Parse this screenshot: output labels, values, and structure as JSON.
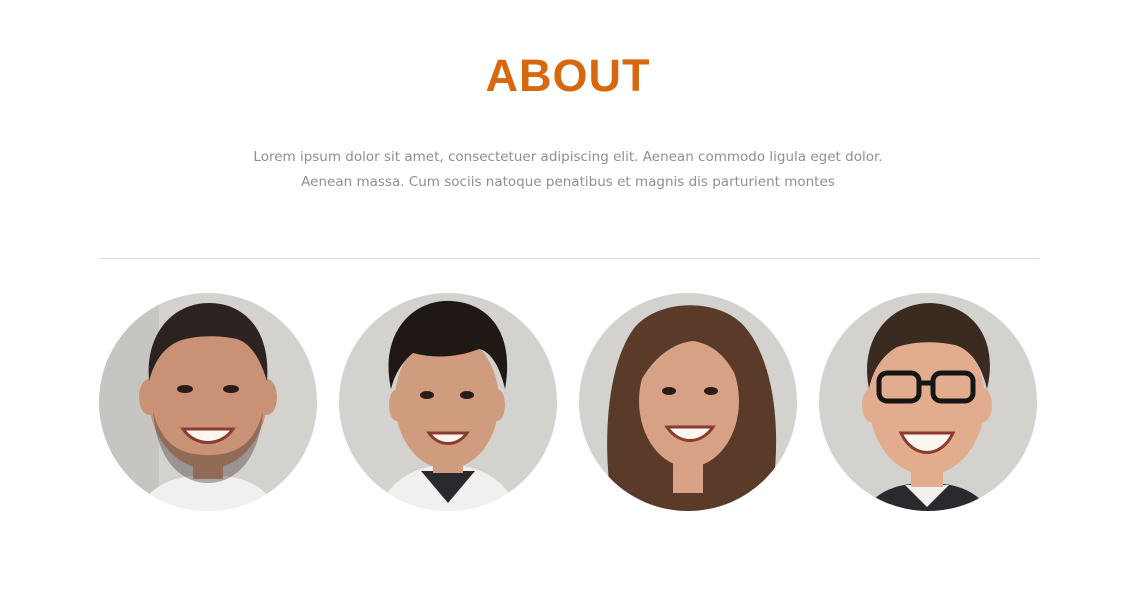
{
  "colors": {
    "accent": "#d8680f",
    "body_text": "#8f8f8f",
    "divider": "#dedede",
    "background": "#ffffff",
    "portrait_backdrop": "#d4d2cf",
    "skin_tones": [
      "#c99276",
      "#cf9c7d",
      "#d6a185",
      "#e1ad8e"
    ],
    "hair_tones": [
      "#2c2320",
      "#201815",
      "#5a3a28",
      "#3a2a20"
    ]
  },
  "about": {
    "title": "ABOUT",
    "description": "Lorem ipsum dolor sit amet, consectetuer adipiscing elit. Aenean commodo ligula eget dolor. Aenean massa. Cum sociis natoque penatibus et magnis dis parturient montes"
  },
  "team": [
    {
      "icon": "bearded-man-smiling-portrait"
    },
    {
      "icon": "dark-haired-man-smiling-portrait"
    },
    {
      "icon": "long-haired-woman-smiling-portrait"
    },
    {
      "icon": "man-with-glasses-laughing-portrait"
    }
  ]
}
